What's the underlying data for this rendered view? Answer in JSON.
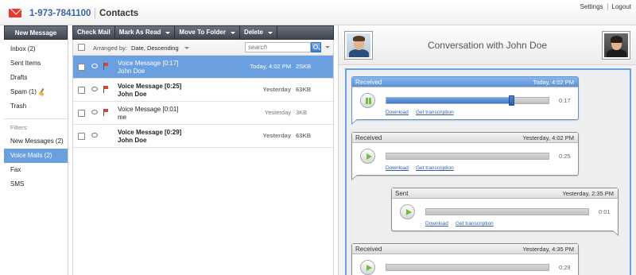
{
  "header": {
    "phone": "1-973-7841100",
    "contacts": "Contacts",
    "settings": "Settings",
    "logout": "Logout"
  },
  "sidebar": {
    "new_message": "New Message",
    "items": [
      {
        "label": "Inbox (2)"
      },
      {
        "label": "Sent Items"
      },
      {
        "label": "Drafts"
      },
      {
        "label": "Spam (1)"
      },
      {
        "label": "Trash"
      }
    ],
    "filters_label": "Filters:",
    "filters": [
      {
        "label": "New Messages (2)"
      },
      {
        "label": "Voice Mails (2)"
      },
      {
        "label": "Fax"
      },
      {
        "label": "SMS"
      }
    ]
  },
  "toolbar": {
    "check_mail": "Check Mail",
    "mark_as_read": "Mark As Read",
    "move_to_folder": "Move To Folder",
    "delete": "Delete"
  },
  "list": {
    "arranged_by_label": "Arranged by:",
    "arranged_by_value": "Date, Descending",
    "search_placeholder": "search",
    "messages": [
      {
        "subject": "Voice Message [0:17]",
        "from": "John Doe",
        "date": "Today, 4:02 PM",
        "size": "2SKB",
        "flagged": true
      },
      {
        "subject": "Voice Message [0:25]",
        "from": "John Doe",
        "date": "Yesterday",
        "size": "63KB",
        "flagged": true
      },
      {
        "subject": "Voice Message [0:01]",
        "from": "me",
        "date": "Yesterday",
        "size": "3KB",
        "flagged": true
      },
      {
        "subject": "Voice Message [0:29]",
        "from": "John Doe",
        "date": "Yesterday",
        "size": "63KB",
        "flagged": false
      }
    ]
  },
  "conversation": {
    "title": "Conversation with John Doe",
    "bubbles": [
      {
        "direction": "Received",
        "time": "Today, 4:02 PM",
        "duration": "0:17",
        "progress": 0.77,
        "playing": true
      },
      {
        "direction": "Received",
        "time": "Yesterday, 4:02 PM",
        "duration": "0:25",
        "progress": 0.0,
        "playing": false
      },
      {
        "direction": "Sent",
        "time": "Yesterday, 2:35 PM",
        "duration": "0:01",
        "progress": 0.0,
        "playing": false
      },
      {
        "direction": "Received",
        "time": "Yesterday, 4:35 PM",
        "duration": "0:29",
        "progress": 0.0,
        "playing": false
      }
    ],
    "download_label": "Download",
    "transcription_label": "Get transcription"
  },
  "colors": {
    "accent": "#6aa0e0",
    "brand_red": "#e43a33",
    "play_green": "#6fbf45"
  }
}
